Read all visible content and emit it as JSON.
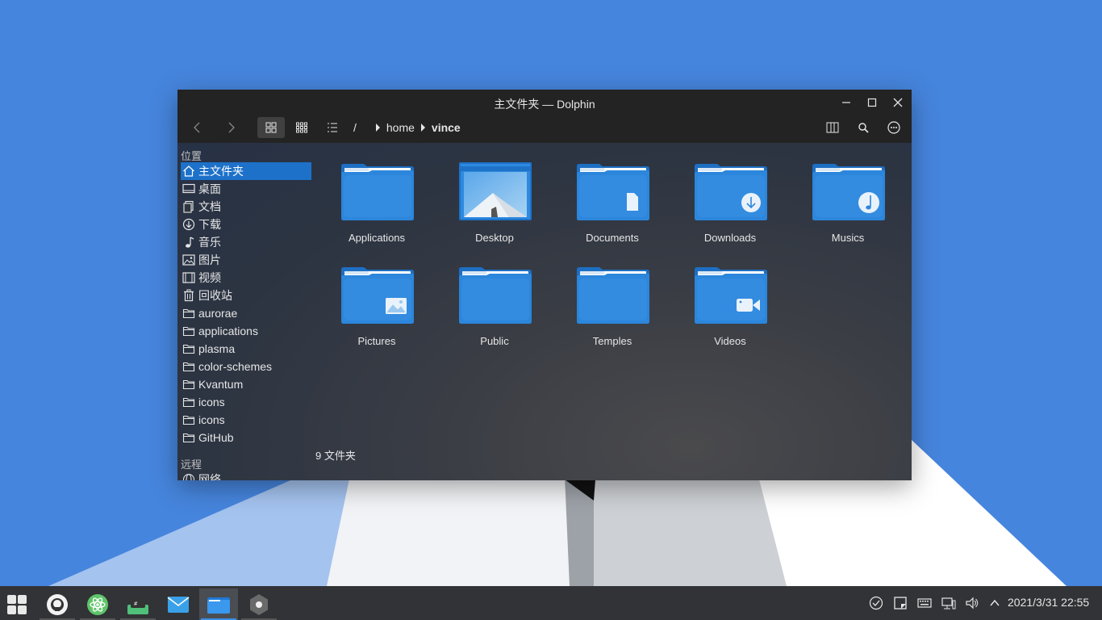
{
  "window": {
    "title": "主文件夹 — Dolphin"
  },
  "breadcrumb": {
    "root": "/",
    "parts": [
      "home",
      "vince"
    ]
  },
  "sidebar": {
    "places_title": "位置",
    "remote_title": "远程",
    "places": [
      {
        "label": "主文件夹",
        "icon": "home-icon",
        "selected": true
      },
      {
        "label": "桌面",
        "icon": "desktop-icon"
      },
      {
        "label": "文档",
        "icon": "documents-icon"
      },
      {
        "label": "下载",
        "icon": "download-icon"
      },
      {
        "label": "音乐",
        "icon": "music-icon"
      },
      {
        "label": "图片",
        "icon": "image-icon"
      },
      {
        "label": "视频",
        "icon": "video-icon"
      },
      {
        "label": "回收站",
        "icon": "trash-icon"
      },
      {
        "label": "aurorae",
        "icon": "folder-icon"
      },
      {
        "label": "applications",
        "icon": "folder-icon"
      },
      {
        "label": "plasma",
        "icon": "folder-icon"
      },
      {
        "label": "color-schemes",
        "icon": "folder-icon"
      },
      {
        "label": "Kvantum",
        "icon": "folder-icon"
      },
      {
        "label": "icons",
        "icon": "folder-icon"
      },
      {
        "label": "icons",
        "icon": "folder-icon"
      },
      {
        "label": "GitHub",
        "icon": "folder-icon"
      }
    ],
    "remote": [
      {
        "label": "网络",
        "icon": "network-icon"
      }
    ]
  },
  "files": [
    {
      "name": "Applications",
      "emblem": "none"
    },
    {
      "name": "Desktop",
      "emblem": "wallpaper"
    },
    {
      "name": "Documents",
      "emblem": "document"
    },
    {
      "name": "Downloads",
      "emblem": "download"
    },
    {
      "name": "Musics",
      "emblem": "music"
    },
    {
      "name": "Pictures",
      "emblem": "picture"
    },
    {
      "name": "Public",
      "emblem": "none"
    },
    {
      "name": "Temples",
      "emblem": "none"
    },
    {
      "name": "Videos",
      "emblem": "video"
    }
  ],
  "status": {
    "text": "9 文件夹"
  },
  "taskbar": {
    "apps": [
      "launcher-icon",
      "github-icon",
      "atom-icon",
      "terminal-icon",
      "mail-icon",
      "file-manager-icon",
      "settings-icon"
    ],
    "clock": "2021/3/31 22:55"
  },
  "colors": {
    "accent": "#1d71c9",
    "folder": "#2b86dc",
    "desktop_bg": "#4685dd"
  }
}
